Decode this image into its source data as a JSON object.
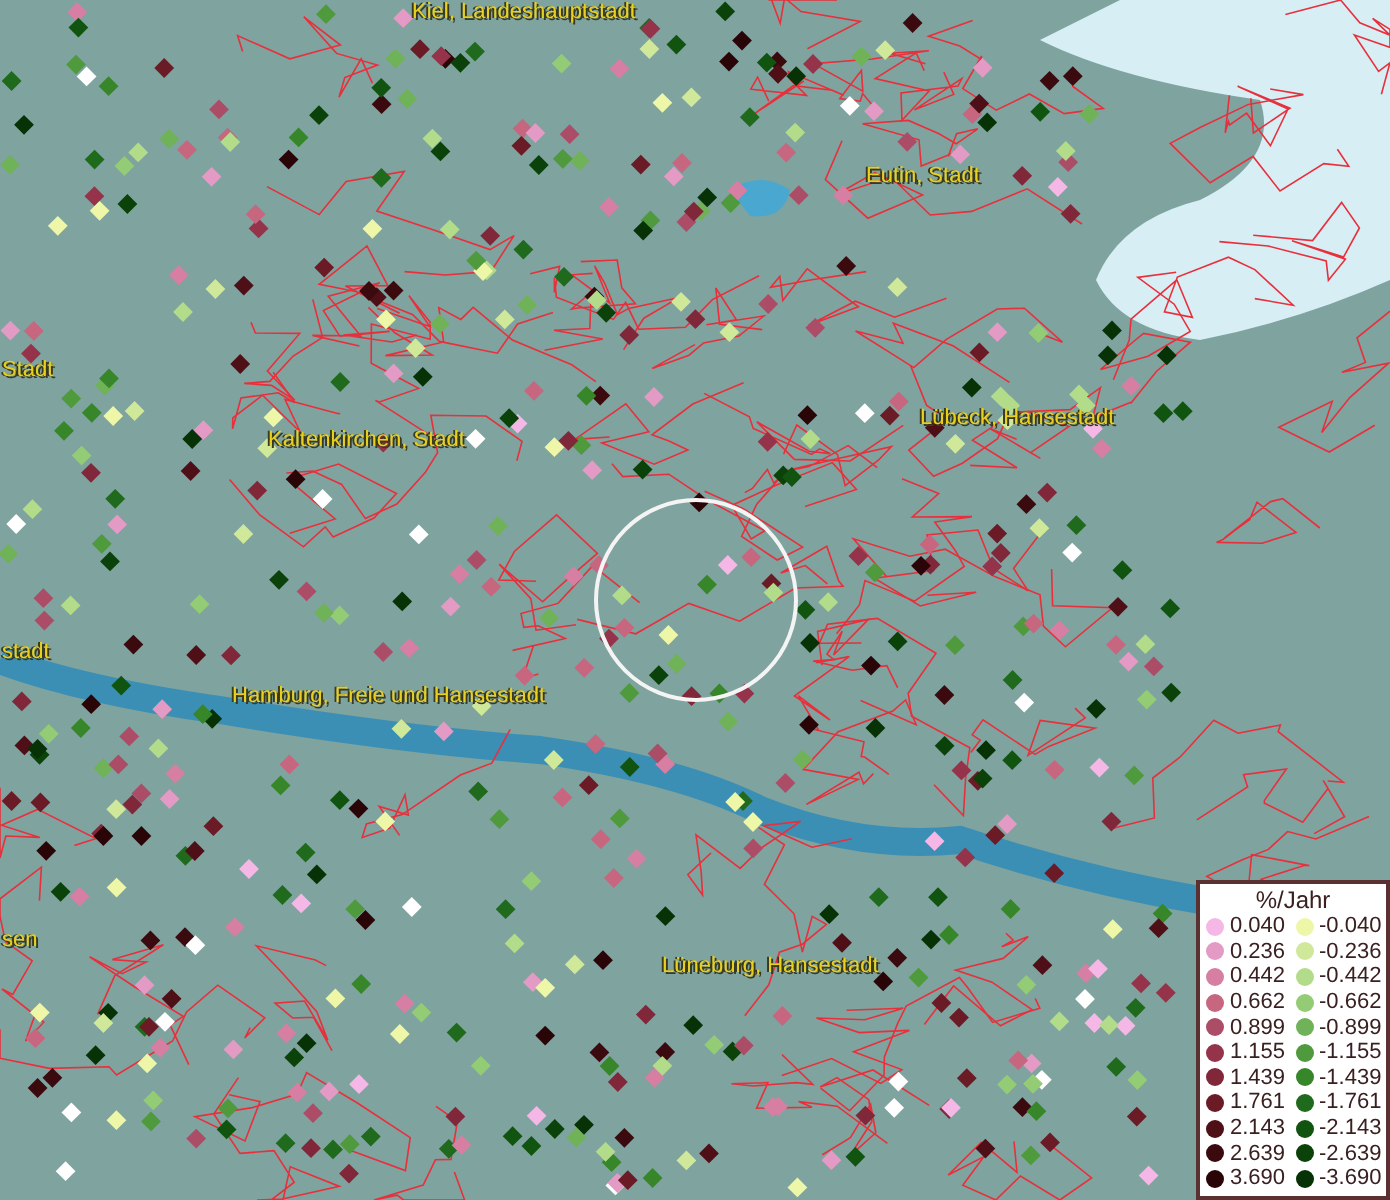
{
  "map": {
    "place_labels": [
      {
        "text": "Kiel, Landeshauptstadt"
      },
      {
        "text": "Eutin, Stadt"
      },
      {
        "text": "Stadt"
      },
      {
        "text": "Kaltenkirchen, Stadt"
      },
      {
        "text": "Lübeck, Hansestadt"
      },
      {
        "text": "stadt"
      },
      {
        "text": "Hamburg, Freie und Hansestadt"
      },
      {
        "text": "sen"
      },
      {
        "text": "Lüneburg, Hansestadt"
      }
    ]
  },
  "legend": {
    "title": "%/Jahr",
    "items": [
      {
        "label": "0.040",
        "color": "#f5b8e6"
      },
      {
        "label": "-0.040",
        "color": "#eef7a8"
      },
      {
        "label": "0.236",
        "color": "#e39ac4"
      },
      {
        "label": "-0.236",
        "color": "#d0e89a"
      },
      {
        "label": "0.442",
        "color": "#d67fa2"
      },
      {
        "label": "-0.442",
        "color": "#b2dc8a"
      },
      {
        "label": "0.662",
        "color": "#c6667f"
      },
      {
        "label": "-0.662",
        "color": "#93cc74"
      },
      {
        "label": "0.899",
        "color": "#ac4d68"
      },
      {
        "label": "-0.899",
        "color": "#70b258"
      },
      {
        "label": "1.155",
        "color": "#94334a"
      },
      {
        "label": "-1.155",
        "color": "#4e9a3c"
      },
      {
        "label": "1.439",
        "color": "#80283a"
      },
      {
        "label": "-1.439",
        "color": "#37862a"
      },
      {
        "label": "1.761",
        "color": "#6a1b25"
      },
      {
        "label": "-1.761",
        "color": "#1f6a1c"
      },
      {
        "label": "2.143",
        "color": "#4e0f16"
      },
      {
        "label": "-2.143",
        "color": "#105410"
      },
      {
        "label": "2.639",
        "color": "#3a0a0e"
      },
      {
        "label": "-2.639",
        "color": "#0a420a"
      },
      {
        "label": "3.690",
        "color": "#2a0508"
      },
      {
        "label": "-3.690",
        "color": "#063206"
      }
    ]
  }
}
